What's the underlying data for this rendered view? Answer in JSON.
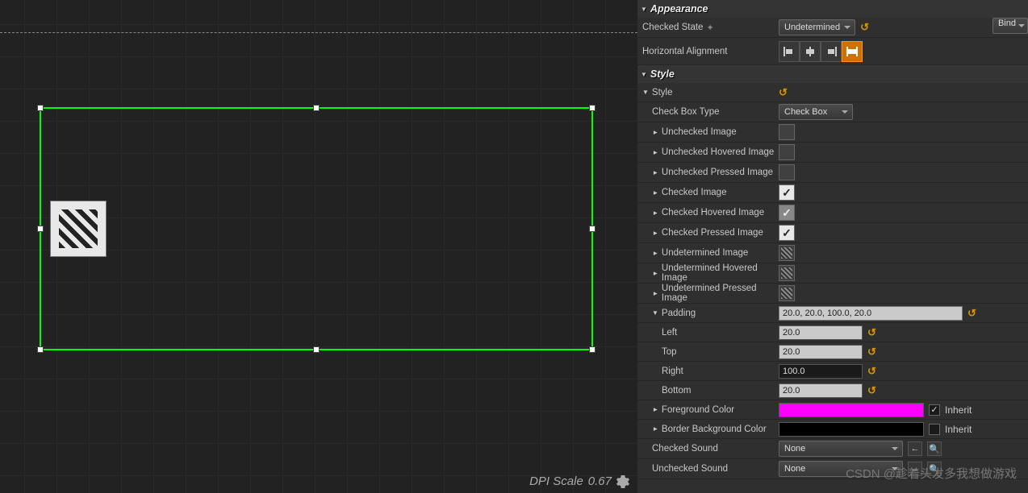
{
  "viewport": {
    "dpi_label": "DPI Scale",
    "dpi_value": "0.67"
  },
  "sections": {
    "appearance": "Appearance",
    "style": "Style"
  },
  "appearance": {
    "checked_state_label": "Checked State",
    "checked_state_value": "Undetermined",
    "halign_label": "Horizontal Alignment",
    "bind_label": "Bind"
  },
  "style": {
    "style_label": "Style",
    "checkbox_type_label": "Check Box Type",
    "checkbox_type_value": "Check Box",
    "unchecked_image": "Unchecked Image",
    "unchecked_hovered": "Unchecked Hovered Image",
    "unchecked_pressed": "Unchecked Pressed Image",
    "checked_image": "Checked Image",
    "checked_hovered": "Checked Hovered Image",
    "checked_pressed": "Checked Pressed Image",
    "undetermined_image": "Undetermined Image",
    "undetermined_hovered": "Undetermined Hovered Image",
    "undetermined_pressed": "Undetermined Pressed Image",
    "padding_label": "Padding",
    "padding_value": "20.0, 20.0, 100.0, 20.0",
    "left_label": "Left",
    "left_value": "20.0",
    "top_label": "Top",
    "top_value": "20.0",
    "right_label": "Right",
    "right_value": "100.0",
    "bottom_label": "Bottom",
    "bottom_value": "20.0",
    "foreground_color": "Foreground Color",
    "border_bg_color": "Border Background Color",
    "inherit_label": "Inherit",
    "checked_sound": "Checked Sound",
    "unchecked_sound": "Unchecked Sound",
    "sound_none": "None"
  },
  "colors": {
    "foreground": "#ff00ff",
    "border_bg": "#000000"
  },
  "watermark": "CSDN @趁着头发多我想做游戏"
}
